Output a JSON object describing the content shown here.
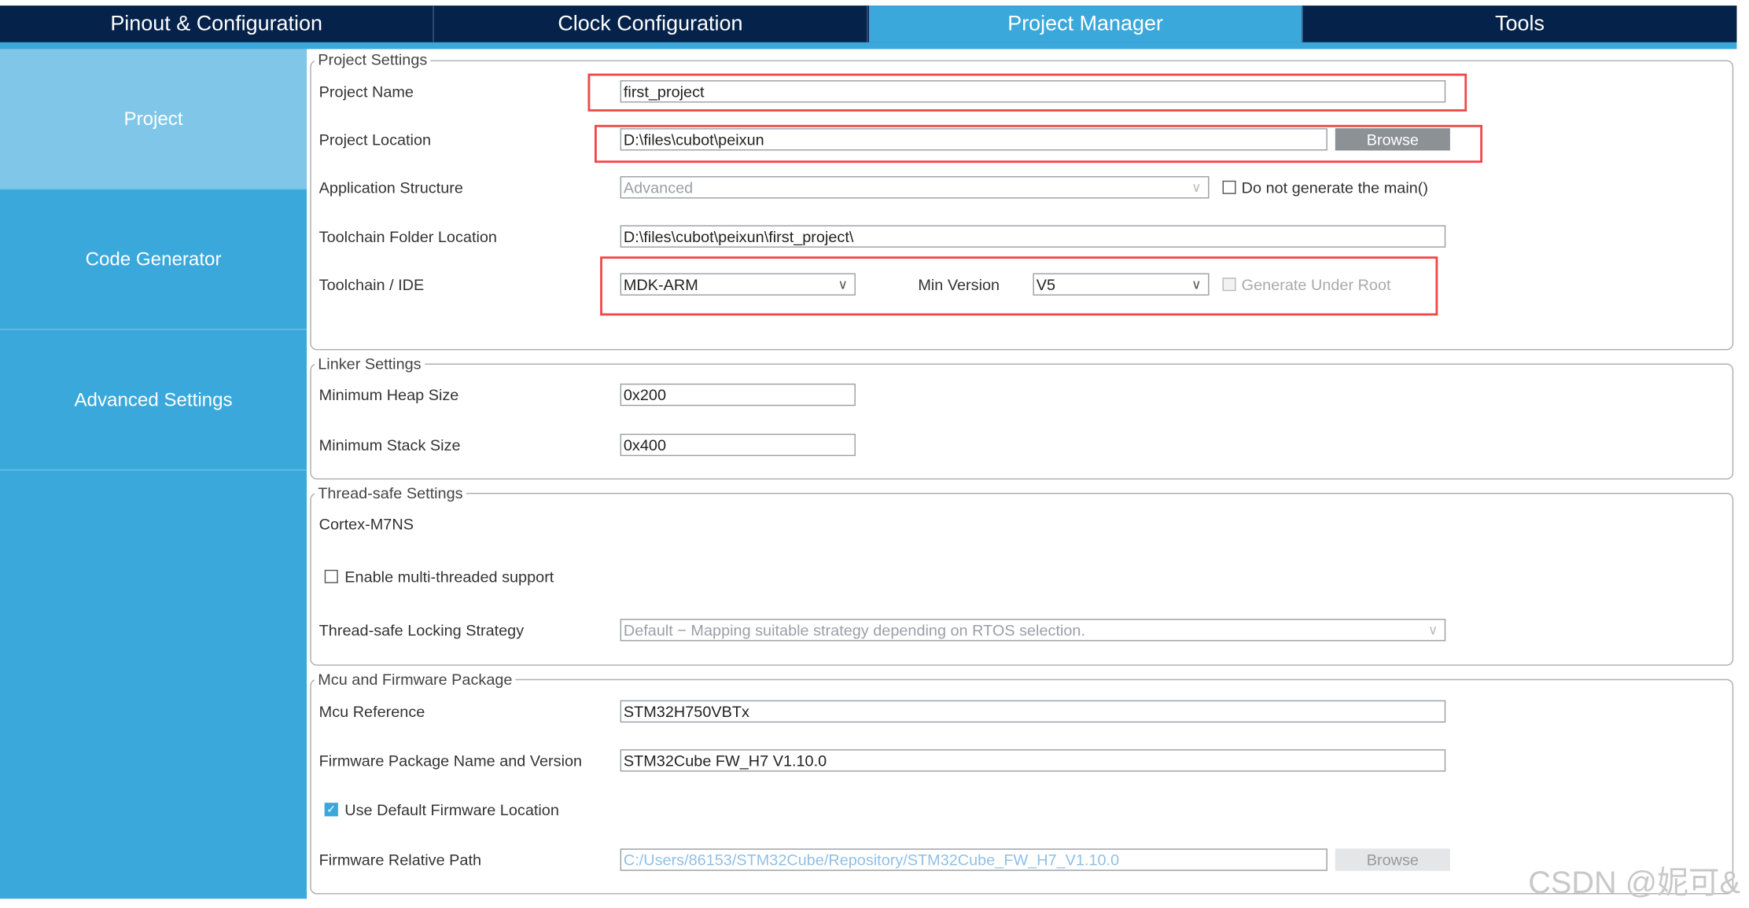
{
  "tabs": [
    {
      "label": "Pinout & Configuration"
    },
    {
      "label": "Clock Configuration"
    },
    {
      "label": "Project Manager",
      "active": true
    },
    {
      "label": "Tools"
    }
  ],
  "sidebar": {
    "items": [
      {
        "label": "Project",
        "active": true
      },
      {
        "label": "Code Generator"
      },
      {
        "label": "Advanced Settings"
      }
    ]
  },
  "project_settings": {
    "legend": "Project Settings",
    "project_name_label": "Project Name",
    "project_name": "first_project",
    "project_location_label": "Project Location",
    "project_location": "D:\\files\\cubot\\peixun",
    "browse": "Browse",
    "app_structure_label": "Application Structure",
    "app_structure": "Advanced",
    "no_main_label": "Do not generate the main()",
    "no_main_checked": false,
    "toolchain_folder_label": "Toolchain Folder Location",
    "toolchain_folder": "D:\\files\\cubot\\peixun\\first_project\\",
    "toolchain_label": "Toolchain / IDE",
    "toolchain": "MDK-ARM",
    "min_version_label": "Min Version",
    "min_version": "V5",
    "gen_under_root_label": "Generate Under Root",
    "gen_under_root_checked": false
  },
  "linker": {
    "legend": "Linker Settings",
    "heap_label": "Minimum Heap Size",
    "heap": "0x200",
    "stack_label": "Minimum Stack Size",
    "stack": "0x400"
  },
  "thread_safe": {
    "legend": "Thread-safe Settings",
    "core": "Cortex-M7NS",
    "multi_label": "Enable multi-threaded support",
    "multi_checked": false,
    "strategy_label": "Thread-safe Locking Strategy",
    "strategy": "Default  −  Mapping suitable strategy depending on RTOS selection."
  },
  "mcu": {
    "legend": "Mcu and Firmware Package",
    "ref_label": "Mcu Reference",
    "ref": "STM32H750VBTx",
    "fw_label": "Firmware Package Name and Version",
    "fw": "STM32Cube FW_H7 V1.10.0",
    "use_default_label": "Use Default Firmware Location",
    "use_default_checked": true,
    "path_label": "Firmware Relative Path",
    "path": "C:/Users/86153/STM32Cube/Repository/STM32Cube_FW_H7_V1.10.0",
    "browse": "Browse"
  },
  "watermark": "CSDN @妮可&",
  "colors": {
    "tab_bg": "#05224a",
    "accent": "#3aa8db",
    "sidebar_active": "#7fc6e8",
    "highlight": "#f04848"
  }
}
